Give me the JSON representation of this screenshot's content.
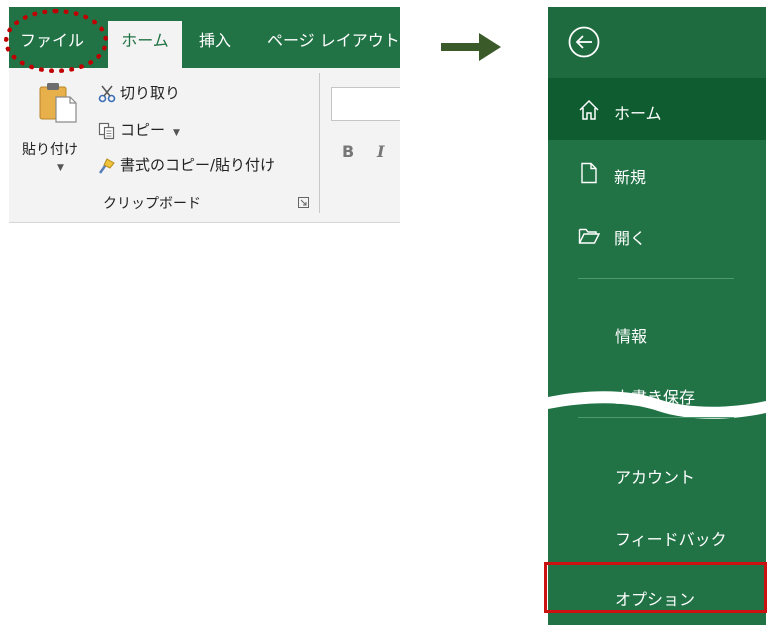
{
  "ribbon": {
    "tabs": [
      {
        "label": "ファイル"
      },
      {
        "label": "ホーム"
      },
      {
        "label": "挿入"
      },
      {
        "label": "ページ レイアウト"
      }
    ],
    "clipboard": {
      "paste_label": "貼り付け",
      "cut_label": "切り取り",
      "copy_label": "コピー",
      "format_painter_label": "書式のコピー/貼り付け",
      "group_label": "クリップボード"
    },
    "font": {
      "bold_label": "B",
      "italic_label": "I"
    }
  },
  "backstage": {
    "items": [
      {
        "label": "ホーム",
        "icon": "home-icon"
      },
      {
        "label": "新規",
        "icon": "new-document-icon"
      },
      {
        "label": "開く",
        "icon": "open-folder-icon"
      },
      {
        "label": "情報"
      },
      {
        "label": "上書き保存"
      },
      {
        "label": "アカウント"
      },
      {
        "label": "フィードバック"
      },
      {
        "label": "オプション"
      }
    ]
  },
  "colors": {
    "excel_green": "#217346",
    "backstage_selected": "#0e5c2f",
    "highlight_red": "#cc1111",
    "arrow_green": "#3a5a2a"
  }
}
